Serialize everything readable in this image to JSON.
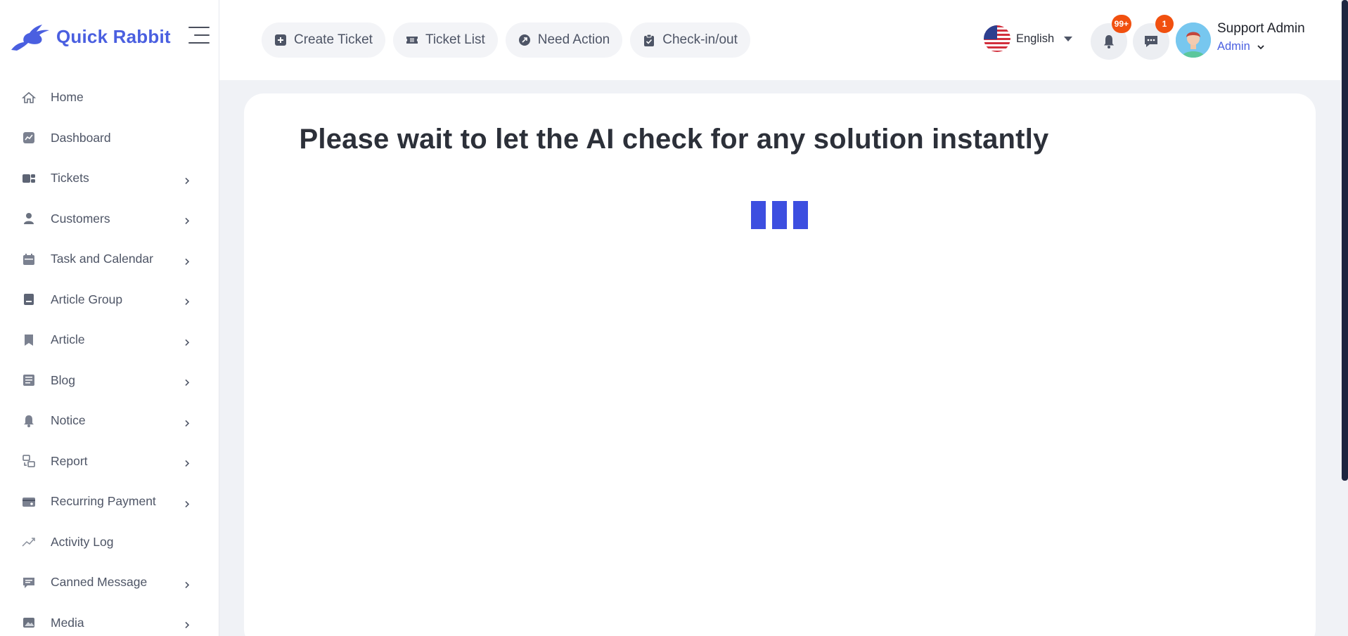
{
  "brand": {
    "name": "Quick Rabbit",
    "logo": "rabbit-logo"
  },
  "sidebar": {
    "items": [
      {
        "label": "Home",
        "icon": "home-icon",
        "has_submenu": false
      },
      {
        "label": "Dashboard",
        "icon": "dashboard-icon",
        "has_submenu": false
      },
      {
        "label": "Tickets",
        "icon": "ticket-icon",
        "has_submenu": true
      },
      {
        "label": "Customers",
        "icon": "user-icon",
        "has_submenu": true
      },
      {
        "label": "Task and Calendar",
        "icon": "calendar-icon",
        "has_submenu": true
      },
      {
        "label": "Article Group",
        "icon": "article-group-icon",
        "has_submenu": true
      },
      {
        "label": "Article",
        "icon": "bookmark-icon",
        "has_submenu": true
      },
      {
        "label": "Blog",
        "icon": "blog-icon",
        "has_submenu": true
      },
      {
        "label": "Notice",
        "icon": "bell-icon",
        "has_submenu": true
      },
      {
        "label": "Report",
        "icon": "report-icon",
        "has_submenu": true
      },
      {
        "label": "Recurring Payment",
        "icon": "card-icon",
        "has_submenu": true
      },
      {
        "label": "Activity Log",
        "icon": "trend-icon",
        "has_submenu": false
      },
      {
        "label": "Canned Message",
        "icon": "message-icon",
        "has_submenu": true
      },
      {
        "label": "Media",
        "icon": "image-icon",
        "has_submenu": true
      }
    ]
  },
  "topbar": {
    "quick_actions": [
      {
        "label": "Create Ticket",
        "icon": "plus-square-icon"
      },
      {
        "label": "Ticket List",
        "icon": "ticket-icon"
      },
      {
        "label": "Need Action",
        "icon": "arrow-circle-icon"
      },
      {
        "label": "Check-in/out",
        "icon": "clipboard-icon"
      }
    ],
    "language": {
      "label": "English",
      "icon": "us-flag-icon"
    },
    "notifications": {
      "badge": "99+",
      "icon": "bell-icon"
    },
    "messages": {
      "badge": "1",
      "icon": "chat-icon"
    },
    "user": {
      "name": "Support Admin",
      "role": "Admin"
    }
  },
  "main": {
    "title": "Please wait to let the AI check for any solution instantly",
    "loader": {
      "bars": 3,
      "color": "#3c4ee0"
    }
  },
  "colors": {
    "brand": "#4a5fe0",
    "badge": "#f1500f",
    "loader": "#3c4ee0"
  }
}
